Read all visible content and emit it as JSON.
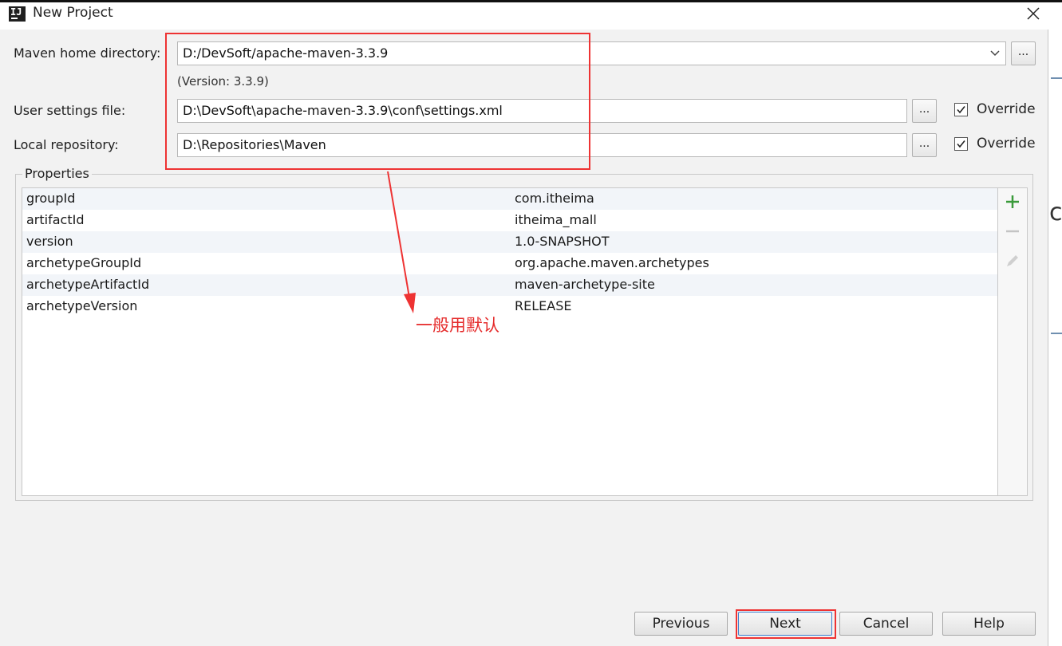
{
  "window": {
    "title": "New Project"
  },
  "form": {
    "maven_home_label": "Maven home directory:",
    "maven_home_value": "D:/DevSoft/apache-maven-3.3.9",
    "version_note": "(Version: 3.3.9)",
    "user_settings_label": "User settings file:",
    "user_settings_value": "D:\\DevSoft\\apache-maven-3.3.9\\conf\\settings.xml",
    "local_repo_label": "Local repository:",
    "local_repo_value": "D:\\Repositories\\Maven",
    "browse_label": "...",
    "override_label": "Override",
    "user_settings_override": true,
    "local_repo_override": true
  },
  "properties": {
    "title": "Properties",
    "rows": [
      {
        "key": "groupId",
        "value": "com.itheima"
      },
      {
        "key": "artifactId",
        "value": "itheima_mall"
      },
      {
        "key": "version",
        "value": "1.0-SNAPSHOT"
      },
      {
        "key": "archetypeGroupId",
        "value": "org.apache.maven.archetypes"
      },
      {
        "key": "archetypeArtifactId",
        "value": "maven-archetype-site"
      },
      {
        "key": "archetypeVersion",
        "value": "RELEASE"
      }
    ],
    "tools": [
      "plus-icon",
      "minus-icon",
      "pencil-icon"
    ]
  },
  "annotation": {
    "text": "一般用默认",
    "color": "#e52b2b"
  },
  "background_fragment": "ce",
  "buttons": {
    "previous": "Previous",
    "next": "Next",
    "cancel": "Cancel",
    "help": "Help"
  },
  "colors": {
    "accent": "#3d7fcf",
    "annotation": "#ee3333",
    "add": "#3a9a3a"
  }
}
